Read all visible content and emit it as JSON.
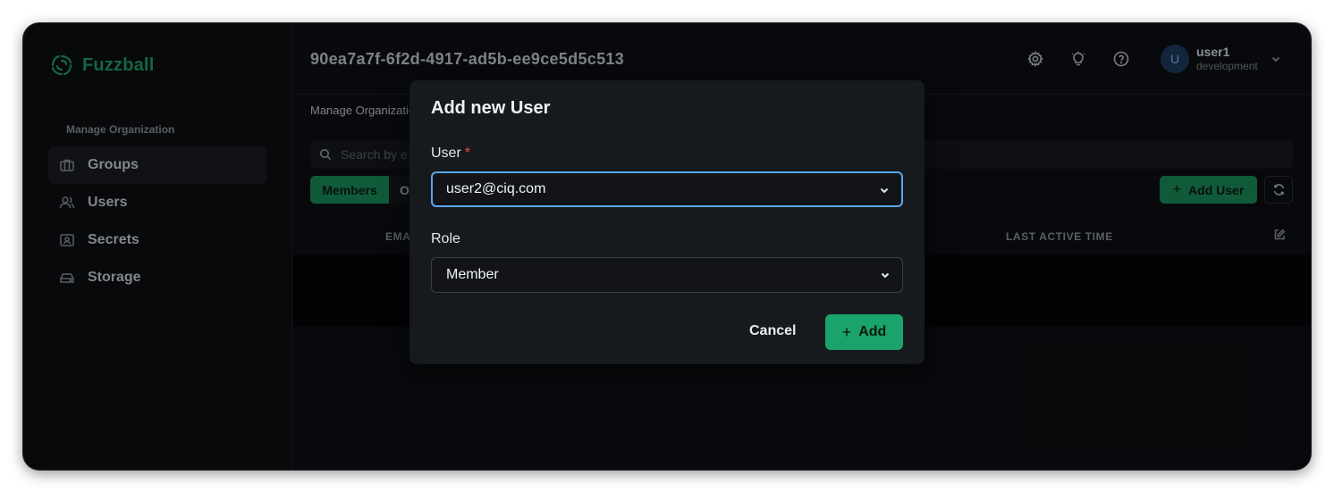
{
  "brand": {
    "name": "Fuzzball",
    "color": "#1f9e66"
  },
  "sidebar": {
    "heading": "Manage Organization",
    "items": [
      {
        "label": "Groups",
        "icon": "briefcase-icon",
        "active": true
      },
      {
        "label": "Users",
        "icon": "users-icon",
        "active": false
      },
      {
        "label": "Secrets",
        "icon": "key-card-icon",
        "active": false
      },
      {
        "label": "Storage",
        "icon": "drive-icon",
        "active": false
      }
    ]
  },
  "header": {
    "title": "90ea7a7f-6f2d-4917-ad5b-ee9ce5d5c513",
    "icons": [
      "settings-gear-icon",
      "lightbulb-icon",
      "help-circle-icon"
    ],
    "user": {
      "avatar_initial": "U",
      "name": "user1",
      "environment": "development"
    }
  },
  "main": {
    "breadcrumb": "Manage Organizatio",
    "search_placeholder": "Search by e",
    "tabs": [
      {
        "label": "Members",
        "active": true
      },
      {
        "label": "O",
        "active": false
      }
    ],
    "add_user_label": "Add User",
    "table": {
      "columns": [
        "EMA",
        "LAST ACTIVE TIME"
      ]
    }
  },
  "modal": {
    "title": "Add new User",
    "user_field": {
      "label": "User",
      "required_mark": "*",
      "value": "user2@ciq.com"
    },
    "role_field": {
      "label": "Role",
      "value": "Member"
    },
    "cancel_label": "Cancel",
    "add_label": "Add"
  },
  "colors": {
    "accent": "#1aa36a",
    "focus": "#5aa7ea",
    "required": "#ef4b4b"
  }
}
